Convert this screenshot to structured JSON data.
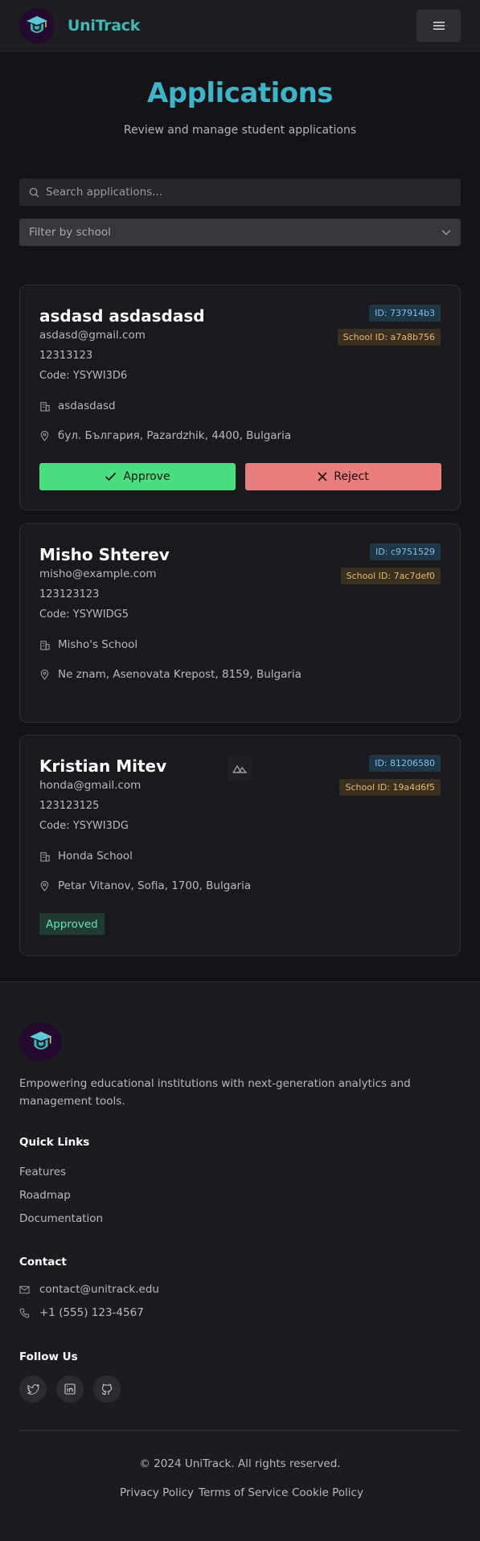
{
  "header": {
    "brand": "UniTrack",
    "menu_icon": "hamburger-icon"
  },
  "hero": {
    "title": "Applications",
    "subtitle": "Review and manage student applications"
  },
  "search": {
    "placeholder": "Search applications..."
  },
  "filter": {
    "label": "Filter by school"
  },
  "applications": [
    {
      "name": "asdasd asdasdasd",
      "email": "asdasd@gmail.com",
      "phone": "12313123",
      "code": "Code: YSYWI3D6",
      "id": "ID: 737914b3",
      "school_id": "School ID: a7a8b756",
      "school": "asdasdasd",
      "address": "бул. България, Pazardzhik, 4400, Bulgaria",
      "approve_label": "Approve",
      "reject_label": "Reject"
    },
    {
      "name": "Misho Shterev",
      "email": "misho@example.com",
      "phone": "123123123",
      "code": "Code: YSYWIDG5",
      "id": "ID: c9751529",
      "school_id": "School ID: 7ac7def0",
      "school": "Misho's School",
      "address": "Ne znam, Asenovata Krepost, 8159, Bulgaria"
    },
    {
      "name": "Kristian Mitev",
      "email": "honda@gmail.com",
      "phone": "123123125",
      "code": "Code: YSYWI3DG",
      "id": "ID: 81206580",
      "school_id": "School ID: 19a4d6f5",
      "school": "Honda School",
      "address": "Petar Vitanov, Sofia, 1700, Bulgaria",
      "status": "Approved"
    }
  ],
  "footer": {
    "description": "Empowering educational institutions with next-generation analytics and management tools.",
    "quick_links_heading": "Quick Links",
    "quick_links": [
      "Features",
      "Roadmap",
      "Documentation"
    ],
    "contact_heading": "Contact",
    "email": "contact@unitrack.edu",
    "phone": "+1 (555) 123-4567",
    "follow_heading": "Follow Us",
    "social_icons": [
      "twitter-icon",
      "linkedin-icon",
      "github-icon"
    ],
    "copyright": "© 2024 UniTrack. All rights reserved.",
    "legal_links": [
      "Privacy Policy",
      "Terms of Service",
      "Cookie Policy"
    ]
  },
  "colors": {
    "accent": "#3fb8b6",
    "approve": "#4ade80",
    "reject": "#e97c7c",
    "background": "#141418"
  }
}
